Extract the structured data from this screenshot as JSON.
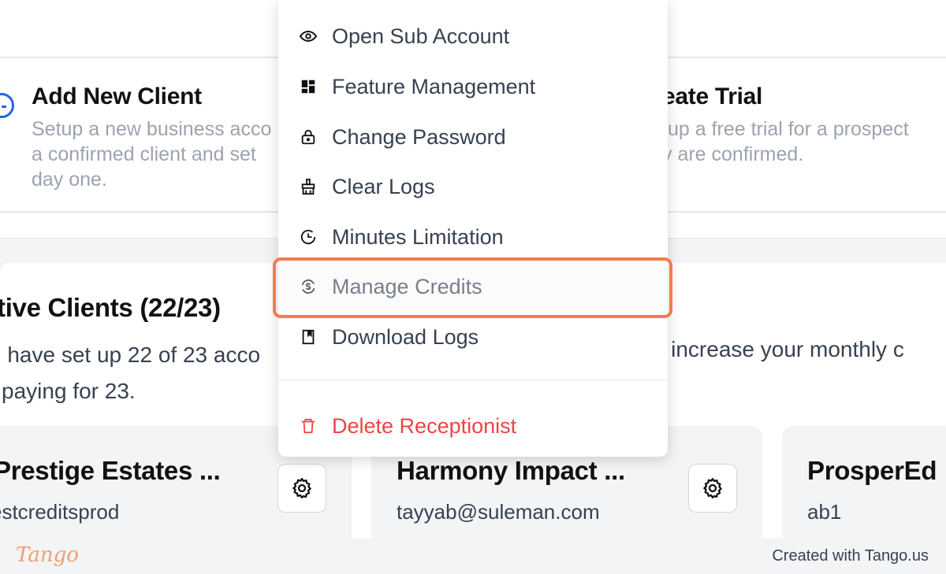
{
  "actions": {
    "add_client": {
      "title": "Add New Client",
      "desc_line1": "Setup a new business acco",
      "desc_line2": "a confirmed client and set",
      "desc_line3": "day one."
    },
    "create_trial": {
      "title": "eate Trial",
      "desc_line1": " up a free trial for a prospect",
      "desc_line2": "y are confirmed."
    }
  },
  "clients": {
    "title": "tive Clients (22/23)",
    "desc_line1": "u have set up 22 of 23 acco",
    "desc_line2": "paying for 23.",
    "desc_right": "ot increase your monthly c"
  },
  "client_cards": [
    {
      "name": "Prestige Estates ...",
      "email": "estcreditsprod"
    },
    {
      "name": "Harmony Impact ...",
      "email": "tayyab@suleman.com"
    },
    {
      "name": "ProsperEd",
      "email": "ab1"
    }
  ],
  "menu": {
    "items": [
      {
        "label": "Open Sub Account",
        "icon": "eye-icon"
      },
      {
        "label": "Feature Management",
        "icon": "grid-icon"
      },
      {
        "label": "Change Password",
        "icon": "lock-icon"
      },
      {
        "label": "Clear Logs",
        "icon": "broom-icon"
      },
      {
        "label": "Minutes Limitation",
        "icon": "clock-icon"
      },
      {
        "label": "Manage Credits",
        "icon": "refresh-dollar-icon"
      },
      {
        "label": "Download Logs",
        "icon": "bookmark-icon"
      }
    ],
    "delete_label": "Delete Receptionist"
  },
  "footer": {
    "logo": "Tango",
    "created_text": "Created with Tango.us"
  },
  "colors": {
    "accent_blue": "#2563eb",
    "highlight_orange": "#f47c4b",
    "danger_red": "#ef4444"
  }
}
